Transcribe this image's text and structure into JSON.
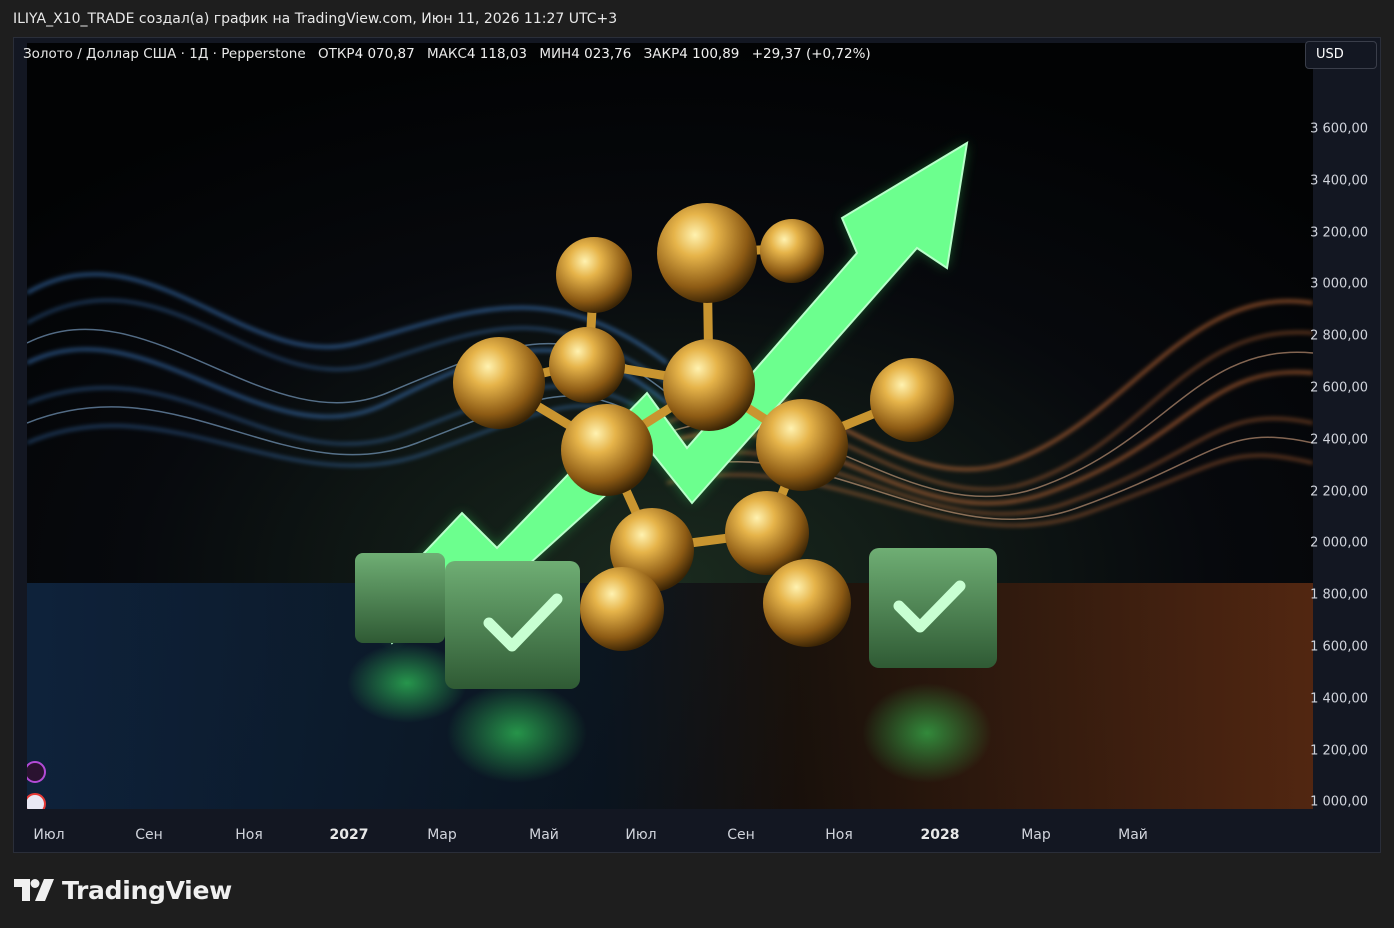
{
  "header": {
    "caption": "ILIYA_X10_TRADE создал(а) график на TradingView.com, Июн 11, 2026 11:27 UTC+3"
  },
  "legend": {
    "symbol": "Золото / Доллар США · 1Д · Pepperstone",
    "open_label": "ОТКР",
    "open": "4 070,87",
    "high_label": "МАКС",
    "high": "4 118,03",
    "low_label": "МИН",
    "low": "4 023,76",
    "close_label": "ЗАКР",
    "close": "4 100,89",
    "change": "+29,37 (+0,72%)"
  },
  "currency_button": "USD",
  "price_axis": {
    "ticks": [
      "3 600,00",
      "3 400,00",
      "3 200,00",
      "3 000,00",
      "2 800,00",
      "2 600,00",
      "2 400,00",
      "2 200,00",
      "2 000,00",
      "1 800,00",
      "1 600,00",
      "1 400,00",
      "1 200,00",
      "1 000,00"
    ]
  },
  "time_axis": {
    "ticks": [
      {
        "label": "Июл",
        "bold": false
      },
      {
        "label": "Сен",
        "bold": false
      },
      {
        "label": "Ноя",
        "bold": false
      },
      {
        "label": "2027",
        "bold": true
      },
      {
        "label": "Мар",
        "bold": false
      },
      {
        "label": "Май",
        "bold": false
      },
      {
        "label": "Июл",
        "bold": false
      },
      {
        "label": "Сен",
        "bold": false
      },
      {
        "label": "Ноя",
        "bold": false
      },
      {
        "label": "2028",
        "bold": true
      },
      {
        "label": "Мар",
        "bold": false
      },
      {
        "label": "Май",
        "bold": false
      }
    ]
  },
  "brand": {
    "name": "TradingView"
  },
  "colors": {
    "background": "#1e1e1e",
    "chart_bg": "#131722",
    "accent_green": "#3dff6a",
    "gold": "#d4a437",
    "wave_blue": "#3f8fe0",
    "wave_orange": "#e0743a"
  }
}
